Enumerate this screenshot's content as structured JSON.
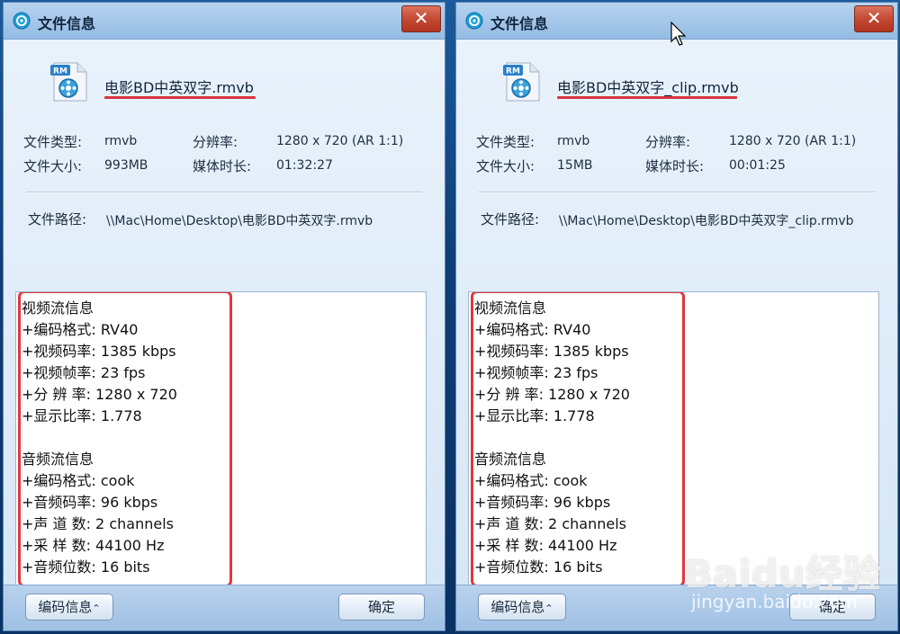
{
  "left": {
    "title": "文件信息",
    "close": "✕",
    "filename": "电影BD中英双字.rmvb",
    "icon_badge": "RM",
    "type_label": "文件类型:",
    "type_value": "rmvb",
    "size_label": "文件大小:",
    "size_value": "993MB",
    "res_label": "分辨率:",
    "res_value": "1280 x 720 (AR 1:1)",
    "dur_label": "媒体时长:",
    "dur_value": "01:32:27",
    "path_label": "文件路径:",
    "path_value": "\\\\Mac\\Home\\Desktop\\电影BD中英双字.rmvb",
    "lines": [
      "视频流信息",
      "+编码格式: RV40",
      "+视频码率: 1385 kbps",
      "+视频帧率: 23 fps",
      "+分 辨 率: 1280 x 720",
      "+显示比率: 1.778",
      "",
      "音频流信息",
      "+编码格式: cook",
      "+音频码率: 96 kbps",
      "+声 道 数: 2 channels",
      "+采 样 数: 44100 Hz",
      "+音频位数: 16 bits"
    ],
    "codec_button": "编码信息",
    "ok_button": "确定"
  },
  "right": {
    "title": "文件信息",
    "close": "✕",
    "filename": "电影BD中英双字_clip.rmvb",
    "icon_badge": "RM",
    "type_label": "文件类型:",
    "type_value": "rmvb",
    "size_label": "文件大小:",
    "size_value": "15MB",
    "res_label": "分辨率:",
    "res_value": "1280 x 720 (AR 1:1)",
    "dur_label": "媒体时长:",
    "dur_value": "00:01:25",
    "path_label": "文件路径:",
    "path_value": "\\\\Mac\\Home\\Desktop\\电影BD中英双字_clip.rmvb",
    "lines": [
      "视频流信息",
      "+编码格式: RV40",
      "+视频码率: 1385 kbps",
      "+视频帧率: 23 fps",
      "+分 辨 率: 1280 x 720",
      "+显示比率: 1.778",
      "",
      "音频流信息",
      "+编码格式: cook",
      "+音频码率: 96 kbps",
      "+声 道 数: 2 channels",
      "+采 样 数: 44100 Hz",
      "+音频位数: 16 bits"
    ],
    "codec_button": "编码信息",
    "ok_button": "确定"
  },
  "watermark": {
    "brand": "Baidu经验",
    "url": "jingyan.baidu.com"
  },
  "colors": {
    "highlight": "#e1373d",
    "close": "#c44a33",
    "titlebar": "#a4c6e9"
  }
}
